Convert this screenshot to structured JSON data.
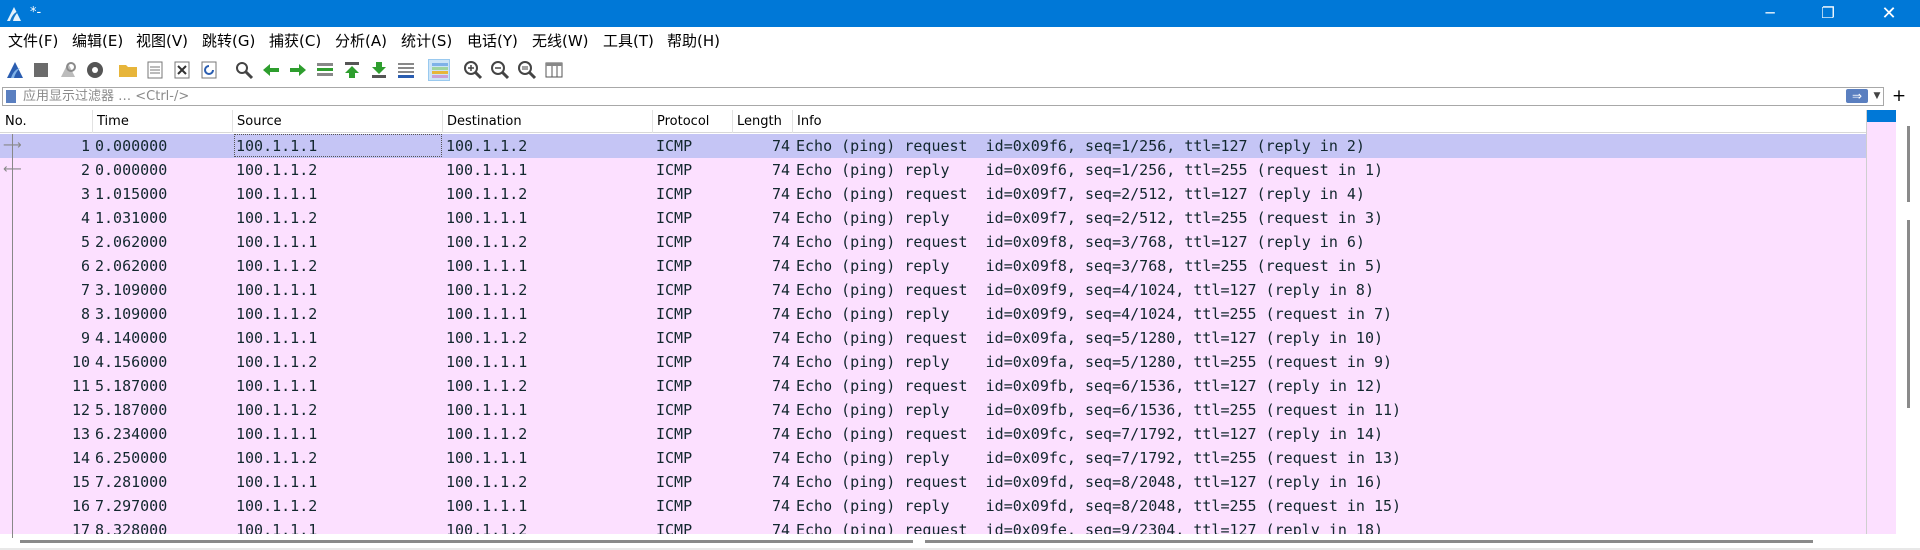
{
  "window": {
    "title": "*-",
    "minimize_icon": "minimize-icon",
    "maximize_icon": "restore-icon",
    "close_icon": "close-icon",
    "min_glyph": "─",
    "max_glyph": "❐",
    "close_glyph": "✕"
  },
  "menu": {
    "items": [
      {
        "label": "文件(F)"
      },
      {
        "label": "编辑(E)"
      },
      {
        "label": "视图(V)"
      },
      {
        "label": "跳转(G)"
      },
      {
        "label": "捕获(C)"
      },
      {
        "label": "分析(A)"
      },
      {
        "label": "统计(S)"
      },
      {
        "label": "电话(Y)"
      },
      {
        "label": "无线(W)"
      },
      {
        "label": "工具(T)"
      },
      {
        "label": "帮助(H)"
      }
    ]
  },
  "toolbar": {
    "icons": [
      "shark-fin-start-icon",
      "stop-icon",
      "restart-icon",
      "capture-options-icon",
      "open-folder-icon",
      "save-file-icon",
      "close-file-icon",
      "reload-icon",
      "find-packet-icon",
      "go-back-icon",
      "go-forward-icon",
      "go-to-packet-icon",
      "first-packet-icon",
      "last-packet-icon",
      "autoscroll-icon",
      "colorize-icon",
      "zoom-in-icon",
      "zoom-out-icon",
      "zoom-normal-icon",
      "resize-columns-icon"
    ],
    "colors": {
      "green": "#2e9e2e",
      "blue": "#2a5db0",
      "gray": "#6b6b6b",
      "folder": "#e7b53a"
    }
  },
  "filter": {
    "placeholder": "应用显示过滤器 … <Ctrl-/>",
    "value": "",
    "apply_glyph": "⇒",
    "dropdown_glyph": "▼",
    "add_glyph": "+"
  },
  "packet_list": {
    "columns": [
      "No.",
      "Time",
      "Source",
      "Destination",
      "Protocol",
      "Length",
      "Info"
    ],
    "row_color": "#fce0ff",
    "selected_color": "#c5c5f5",
    "rows": [
      {
        "no": "1",
        "time": "0.000000",
        "src": "100.1.1.1",
        "dst": "100.1.1.2",
        "proto": "ICMP",
        "len": "74",
        "info": "Echo (ping) request  id=0x09f6, seq=1/256, ttl=127 (reply in 2)"
      },
      {
        "no": "2",
        "time": "0.000000",
        "src": "100.1.1.2",
        "dst": "100.1.1.1",
        "proto": "ICMP",
        "len": "74",
        "info": "Echo (ping) reply    id=0x09f6, seq=1/256, ttl=255 (request in 1)"
      },
      {
        "no": "3",
        "time": "1.015000",
        "src": "100.1.1.1",
        "dst": "100.1.1.2",
        "proto": "ICMP",
        "len": "74",
        "info": "Echo (ping) request  id=0x09f7, seq=2/512, ttl=127 (reply in 4)"
      },
      {
        "no": "4",
        "time": "1.031000",
        "src": "100.1.1.2",
        "dst": "100.1.1.1",
        "proto": "ICMP",
        "len": "74",
        "info": "Echo (ping) reply    id=0x09f7, seq=2/512, ttl=255 (request in 3)"
      },
      {
        "no": "5",
        "time": "2.062000",
        "src": "100.1.1.1",
        "dst": "100.1.1.2",
        "proto": "ICMP",
        "len": "74",
        "info": "Echo (ping) request  id=0x09f8, seq=3/768, ttl=127 (reply in 6)"
      },
      {
        "no": "6",
        "time": "2.062000",
        "src": "100.1.1.2",
        "dst": "100.1.1.1",
        "proto": "ICMP",
        "len": "74",
        "info": "Echo (ping) reply    id=0x09f8, seq=3/768, ttl=255 (request in 5)"
      },
      {
        "no": "7",
        "time": "3.109000",
        "src": "100.1.1.1",
        "dst": "100.1.1.2",
        "proto": "ICMP",
        "len": "74",
        "info": "Echo (ping) request  id=0x09f9, seq=4/1024, ttl=127 (reply in 8)"
      },
      {
        "no": "8",
        "time": "3.109000",
        "src": "100.1.1.2",
        "dst": "100.1.1.1",
        "proto": "ICMP",
        "len": "74",
        "info": "Echo (ping) reply    id=0x09f9, seq=4/1024, ttl=255 (request in 7)"
      },
      {
        "no": "9",
        "time": "4.140000",
        "src": "100.1.1.1",
        "dst": "100.1.1.2",
        "proto": "ICMP",
        "len": "74",
        "info": "Echo (ping) request  id=0x09fa, seq=5/1280, ttl=127 (reply in 10)"
      },
      {
        "no": "10",
        "time": "4.156000",
        "src": "100.1.1.2",
        "dst": "100.1.1.1",
        "proto": "ICMP",
        "len": "74",
        "info": "Echo (ping) reply    id=0x09fa, seq=5/1280, ttl=255 (request in 9)"
      },
      {
        "no": "11",
        "time": "5.187000",
        "src": "100.1.1.1",
        "dst": "100.1.1.2",
        "proto": "ICMP",
        "len": "74",
        "info": "Echo (ping) request  id=0x09fb, seq=6/1536, ttl=127 (reply in 12)"
      },
      {
        "no": "12",
        "time": "5.187000",
        "src": "100.1.1.2",
        "dst": "100.1.1.1",
        "proto": "ICMP",
        "len": "74",
        "info": "Echo (ping) reply    id=0x09fb, seq=6/1536, ttl=255 (request in 11)"
      },
      {
        "no": "13",
        "time": "6.234000",
        "src": "100.1.1.1",
        "dst": "100.1.1.2",
        "proto": "ICMP",
        "len": "74",
        "info": "Echo (ping) request  id=0x09fc, seq=7/1792, ttl=127 (reply in 14)"
      },
      {
        "no": "14",
        "time": "6.250000",
        "src": "100.1.1.2",
        "dst": "100.1.1.1",
        "proto": "ICMP",
        "len": "74",
        "info": "Echo (ping) reply    id=0x09fc, seq=7/1792, ttl=255 (request in 13)"
      },
      {
        "no": "15",
        "time": "7.281000",
        "src": "100.1.1.1",
        "dst": "100.1.1.2",
        "proto": "ICMP",
        "len": "74",
        "info": "Echo (ping) request  id=0x09fd, seq=8/2048, ttl=127 (reply in 16)"
      },
      {
        "no": "16",
        "time": "7.297000",
        "src": "100.1.1.2",
        "dst": "100.1.1.1",
        "proto": "ICMP",
        "len": "74",
        "info": "Echo (ping) reply    id=0x09fd, seq=8/2048, ttl=255 (request in 15)"
      },
      {
        "no": "17",
        "time": "8.328000",
        "src": "100.1.1.1",
        "dst": "100.1.1.2",
        "proto": "ICMP",
        "len": "74",
        "info": "Echo (ping) request  id=0x09fe, seq=9/2304, ttl=127 (reply in 18)"
      }
    ],
    "selected_row": "1"
  }
}
